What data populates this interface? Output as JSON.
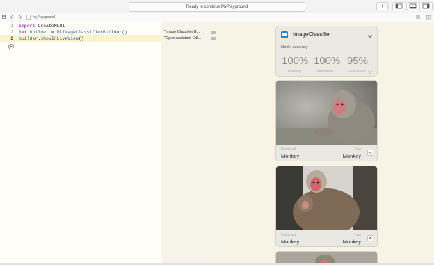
{
  "toolbar": {
    "status": "Ready to continue MyPlayground",
    "add_label": "+"
  },
  "nav": {
    "breadcrumb": "MyPlayground"
  },
  "editor": {
    "lines": [
      {
        "num": "1",
        "t1": "import",
        "t2": " CreateMLUI",
        "t3": "",
        "t4": ""
      },
      {
        "num": "2",
        "t1": "let",
        "t2": " builder",
        "t3": " = ",
        "t4": "MLImageClassifierBuilder()"
      },
      {
        "num": "3",
        "t1": "builder",
        "t2": ".",
        "t3": "showInLiveView",
        "t4": "()"
      }
    ]
  },
  "results": [
    "\"Image Classifier B...",
    "\"Open Assistant Edi..."
  ],
  "live_view": {
    "title": "ImageClassifier",
    "accuracy_label": "Model accuracy",
    "metrics": [
      {
        "value": "100%",
        "label": "Training"
      },
      {
        "value": "100%",
        "label": "Validation"
      },
      {
        "value": "95%",
        "label": "Evaluation"
      }
    ],
    "predictions": [
      {
        "predicted_label": "Predicted",
        "predicted": "Monkey",
        "true_label": "True",
        "true": "Monkey"
      },
      {
        "predicted_label": "Predicted",
        "predicted": "Monkey",
        "true_label": "True",
        "true": "Monkey"
      }
    ]
  }
}
